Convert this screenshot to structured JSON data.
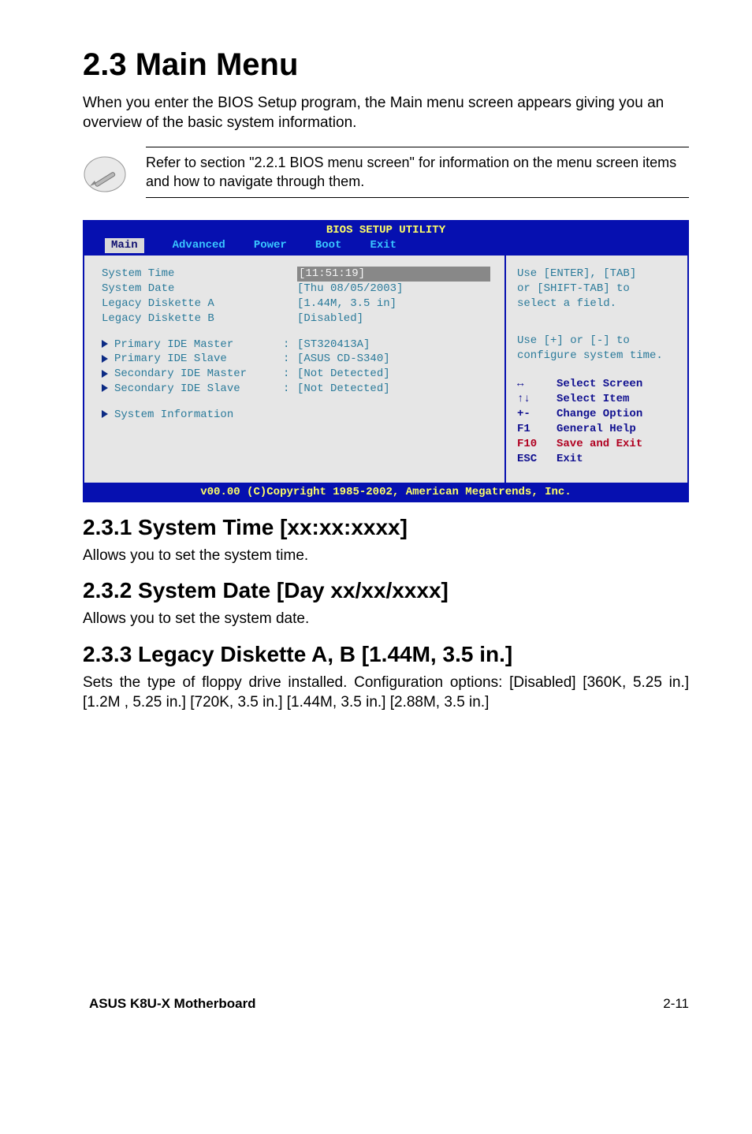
{
  "heading": "2.3 Main Menu",
  "intro": "When you enter the BIOS Setup program, the Main menu screen appears giving you an overview of the basic system information.",
  "note": "Refer to section \"2.2.1  BIOS menu screen\" for information on the menu screen items and how to navigate through them.",
  "bios": {
    "title": "BIOS SETUP UTILITY",
    "tabs": [
      "Main",
      "Advanced",
      "Power",
      "Boot",
      "Exit"
    ],
    "rows_top": [
      {
        "label": "System Time",
        "colon": "",
        "value": "[11:51:19]"
      },
      {
        "label": "System Date",
        "colon": "",
        "value": "[Thu 08/05/2003]"
      },
      {
        "label": "Legacy Diskette A",
        "colon": "",
        "value": "[1.44M, 3.5 in]"
      },
      {
        "label": "Legacy Diskette B",
        "colon": "",
        "value": "[Disabled]"
      }
    ],
    "rows_sub": [
      {
        "label": "Primary IDE Master",
        "colon": ":",
        "value": "[ST320413A]"
      },
      {
        "label": "Primary IDE Slave",
        "colon": ":",
        "value": "[ASUS CD-S340]"
      },
      {
        "label": "Secondary IDE Master",
        "colon": ":",
        "value": "[Not Detected]"
      },
      {
        "label": "Secondary IDE Slave",
        "colon": ":",
        "value": "[Not Detected]"
      }
    ],
    "rows_sub2": [
      {
        "label": "System Information",
        "colon": "",
        "value": ""
      }
    ],
    "help1": "Use [ENTER], [TAB]",
    "help2": "or [SHIFT-TAB] to",
    "help3": "select a field.",
    "help4": "Use [+] or [-] to",
    "help5": "configure system time.",
    "legend": [
      {
        "key": "↔",
        "text": "Select Screen"
      },
      {
        "key": "↑↓",
        "text": "Select Item"
      },
      {
        "key": "+-",
        "text": "Change Option"
      },
      {
        "key": "F1",
        "text": "General Help"
      },
      {
        "key": "F10",
        "text": "Save and Exit",
        "save": true
      },
      {
        "key": "ESC",
        "text": "Exit"
      }
    ],
    "footer": "v00.00 (C)Copyright 1985-2002, American Megatrends, Inc."
  },
  "sections": [
    {
      "title": "2.3.1   System Time [xx:xx:xxxx]",
      "body": "Allows you to set the system time."
    },
    {
      "title": "2.3.2   System Date [Day xx/xx/xxxx]",
      "body": "Allows you to set the system date."
    },
    {
      "title": "2.3.3   Legacy Diskette A, B [1.44M, 3.5 in.]",
      "body": "Sets the type of floppy drive installed. Configuration options: [Disabled] [360K, 5.25 in.] [1.2M , 5.25 in.] [720K, 3.5 in.] [1.44M, 3.5 in.] [2.88M, 3.5 in.]"
    }
  ],
  "footer_left": "ASUS K8U-X Motherboard",
  "footer_right": "2-11"
}
